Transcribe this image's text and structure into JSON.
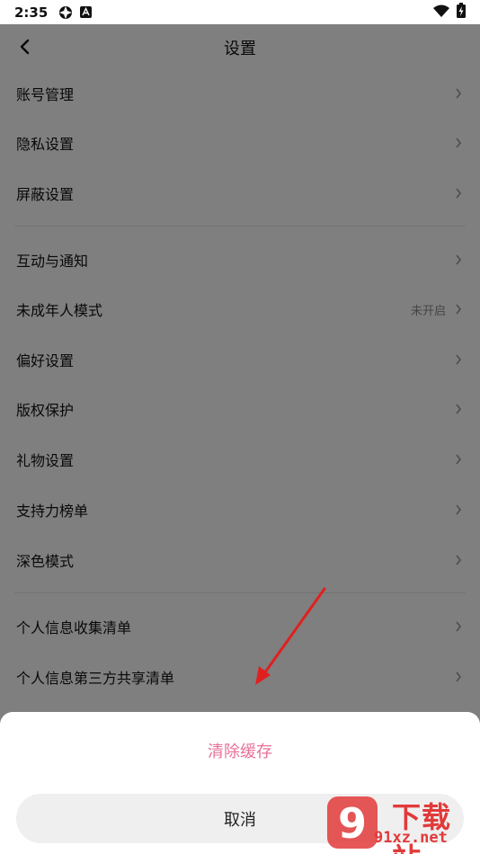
{
  "status_bar": {
    "time": "2:35"
  },
  "header": {
    "title": "设置"
  },
  "settings": {
    "group1": [
      {
        "label": "账号管理"
      },
      {
        "label": "隐私设置"
      },
      {
        "label": "屏蔽设置"
      }
    ],
    "group2": [
      {
        "label": "互动与通知"
      },
      {
        "label": "未成年人模式",
        "value": "未开启"
      },
      {
        "label": "偏好设置"
      },
      {
        "label": "版权保护"
      },
      {
        "label": "礼物设置"
      },
      {
        "label": "支持力榜单"
      },
      {
        "label": "深色模式"
      }
    ],
    "group3": [
      {
        "label": "个人信息收集清单"
      },
      {
        "label": "个人信息第三方共享清单"
      }
    ]
  },
  "sheet": {
    "clear_cache_label": "清除缓存",
    "cancel_label": "取消"
  },
  "watermark": {
    "brand": "下载站",
    "url": "91xz.net",
    "logo_number": "9"
  },
  "colors": {
    "accent": "#e7709a",
    "watermark": "#e23a3a",
    "annotation_arrow": "#e02020"
  }
}
